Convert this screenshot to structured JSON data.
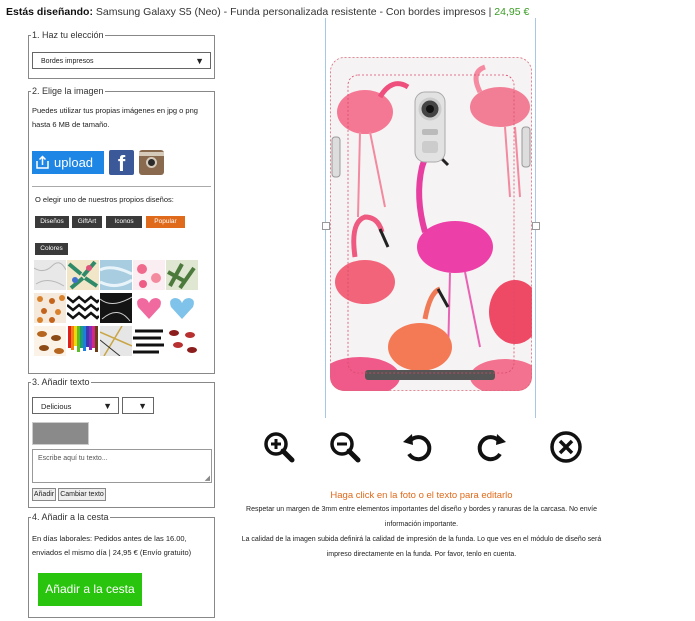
{
  "header": {
    "label": "Estás diseñando:",
    "product": "Samsung Galaxy S5 (Neo) - Funda personalizada resistente - Con bordes impresos |",
    "price": "24,95 €"
  },
  "step1": {
    "legend": "1. Haz tu elección",
    "select_value": "Bordes impresos"
  },
  "step2": {
    "legend": "2. Elige la imagen",
    "intro": "Puedes utilizar tus propias imágenes en jpg o png hasta 6 MB de tamaño.",
    "upload_label": "upload",
    "facebook_letter": "f",
    "designs_intro": "O elegir uno de nuestros propios diseños:",
    "tags": [
      "Diseños",
      "GiftArt",
      "Iconos",
      "Popular",
      "Colores"
    ],
    "active_tag": "Popular",
    "thumbnails": [
      "marble",
      "tropical-leaves",
      "blue-marble",
      "flamingos",
      "palm-leaves",
      "orange-pattern",
      "zigzag",
      "black-marble",
      "pink-heart",
      "blue-heart",
      "dogs",
      "color-pencils",
      "gold-marble",
      "black-stripes",
      "lips"
    ]
  },
  "step3": {
    "legend": "3. Añadir texto",
    "font_value": "Delicious",
    "size_value": "",
    "placeholder": "Escribe aquí tu texto...",
    "add_button": "Añadir",
    "change_button": "Cambiar texto"
  },
  "step4": {
    "legend": "4. Añadir a la cesta",
    "info": "En días laborales: Pedidos antes de las 16.00, enviados el mismo día | 24,95 € (Envío gratuito)",
    "cart_button": "Añadir a la cesta"
  },
  "tools": [
    "zoom-in-icon",
    "zoom-out-icon",
    "rotate-left-icon",
    "rotate-right-icon",
    "remove-icon"
  ],
  "notes": {
    "edit_hint": "Haga click en la foto o el texto para editarlo",
    "margin_line1": "Respetar un margen de 3mm entre elementos importantes del diseño y bordes y ranuras de la carcasa. No envíe",
    "margin_line2": "información importante.",
    "quality_line1": "La calidad de la imagen subida definirá la calidad de impresión de la funda. Lo que ves en el módulo de diseño será",
    "quality_line2": "impreso directamente en la funda. Por favor, tenlo en cuenta."
  },
  "colors": {
    "upload": "#1e87e6",
    "facebook": "#3b5998",
    "tag_active": "#e06a1b",
    "cart": "#28c40e",
    "price": "#3a9d23",
    "hint": "#e06a1b",
    "guide": "#a7c7e7"
  }
}
